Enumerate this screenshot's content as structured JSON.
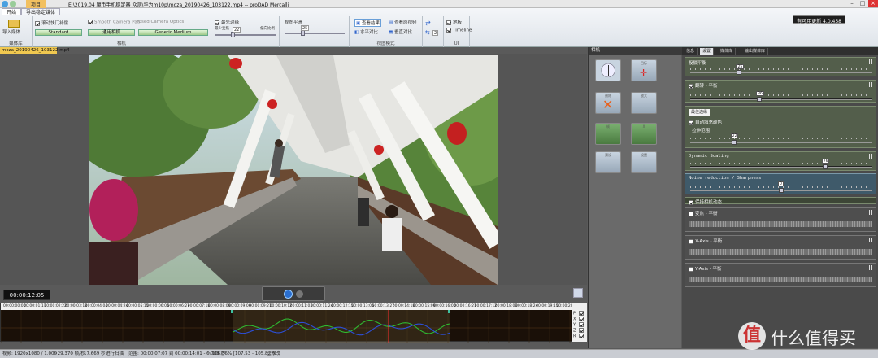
{
  "window": {
    "title": "E:\\2019.04 魔币手机稳定器 众测\\华为m10p\\moza_20190426_103122.mp4 -- proDAD Mercalli",
    "tab_highlight": "项目",
    "update_button": "有可用更新 4.0.458",
    "min_icon": "minimize-icon",
    "max_icon": "maximize-icon",
    "close_icon": "close-icon"
  },
  "ribbon": {
    "tabs": [
      "开始",
      "导出稳定媒体"
    ],
    "import_label": "导入媒体...",
    "media_library_group": "媒体库",
    "rolling_shutter_label": "滚动快门补偿",
    "smooth_camera_label": "Smooth Camera Path",
    "used_camera_label": "Used Camera Optics",
    "rolling_shutter_value": "Standard",
    "smooth_camera_value": "通用相机",
    "used_camera_value": "Generic Medium",
    "camera_group": "相机",
    "border_crop_label": "最先边缘",
    "zoom_label": "最少变焦",
    "zoom_value": "22",
    "stretch_label": "偏向比例",
    "horiz_label": "视图平滑",
    "horiz_value": "25",
    "overview_btn": "查看结果",
    "compare_btn": "查看原视频",
    "horizontal_btn": "水平对比",
    "vertical_btn": "垂直对比",
    "view_group": "视图模式",
    "spin_value": "2",
    "toolbar_checkbox": "地板",
    "timeline_checkbox": "Timeline",
    "ui_group": "UI"
  },
  "document_tab": "moza_20190426_103122.mp4",
  "player": {
    "timecode": "00:00:12:05",
    "ruler_times": [
      "00:00:00:00",
      "00:00:01:11",
      "00:00:02:22",
      "00:00:03:13",
      "00:00:04:04",
      "00:00:04:24",
      "00:00:05:15",
      "00:00:06:06",
      "00:00:06:27",
      "00:00:07:18",
      "00:00:08:09",
      "00:00:09:00",
      "00:00:09:21",
      "00:00:10:12",
      "00:00:11:03",
      "00:00:11:24",
      "00:00:12:15",
      "00:00:13:06",
      "00:00:13:27",
      "00:00:14:18",
      "00:00:15:09",
      "00:00:16:00",
      "00:00:16:21",
      "00:00:17:12",
      "00:00:18:03",
      "00:00:18:24",
      "00:00:19:15",
      "00:00:20:06"
    ],
    "track_labels": [
      "P",
      "X",
      "Y",
      "Z",
      "R"
    ]
  },
  "middle_panel": {
    "header": "相机",
    "buttons": [
      {
        "name": "position",
        "label": ""
      },
      {
        "name": "target",
        "label": "目标"
      },
      {
        "name": "delete",
        "label": "删除"
      },
      {
        "name": "clip-1",
        "label": "放大"
      },
      {
        "name": "clip-2",
        "label": "帧"
      },
      {
        "name": "clip-3",
        "label": "X"
      },
      {
        "name": "clip-4",
        "label": "预设"
      },
      {
        "name": "clip-5",
        "label": "设置"
      }
    ]
  },
  "right_panel": {
    "tabs": [
      "信息",
      "设置",
      "媒体库",
      "输出媒体库"
    ],
    "active_tab": "设置",
    "sections": [
      {
        "title": "投摄平衡",
        "value": "25",
        "knob": 0.27
      },
      {
        "title": "翻转 - 平衡",
        "value": "36",
        "knob": 0.38,
        "checked": true
      },
      {
        "title": "最佳边缘",
        "sub_check": "自动填充颜色",
        "sub_label": "拉伸范围",
        "value": "22",
        "knob": 0.24
      },
      {
        "title": "Dynamic Scaling",
        "value": "76",
        "knob": 0.74
      },
      {
        "title": "Noise reduction / Sharpness",
        "value": "0",
        "knob": 0.5
      }
    ],
    "keep_camera_label": "保持相机动态",
    "collapsed": [
      "变焦 - 平衡",
      "X-Axis - 平衡",
      "Y-Axis - 平衡"
    ]
  },
  "status": {
    "video": "视频: 1920x1080 / 1.000",
    "rate1": "~29.370 帧/秒",
    "rate2": "17.669 秒",
    "mode": "进行扫描",
    "range": "范围: 00:00:07:07 到 00:00:14:01 - 6.708 秒",
    "scale": "~106.36% [107.53 - 105.82]%",
    "state": "已修改"
  },
  "watermark": "什么值得买",
  "colors": {
    "accent_green": "#9fc98a",
    "curve_blue": "#2c4fd8",
    "curve_green": "#2fb830",
    "marker": "#ff3030"
  }
}
